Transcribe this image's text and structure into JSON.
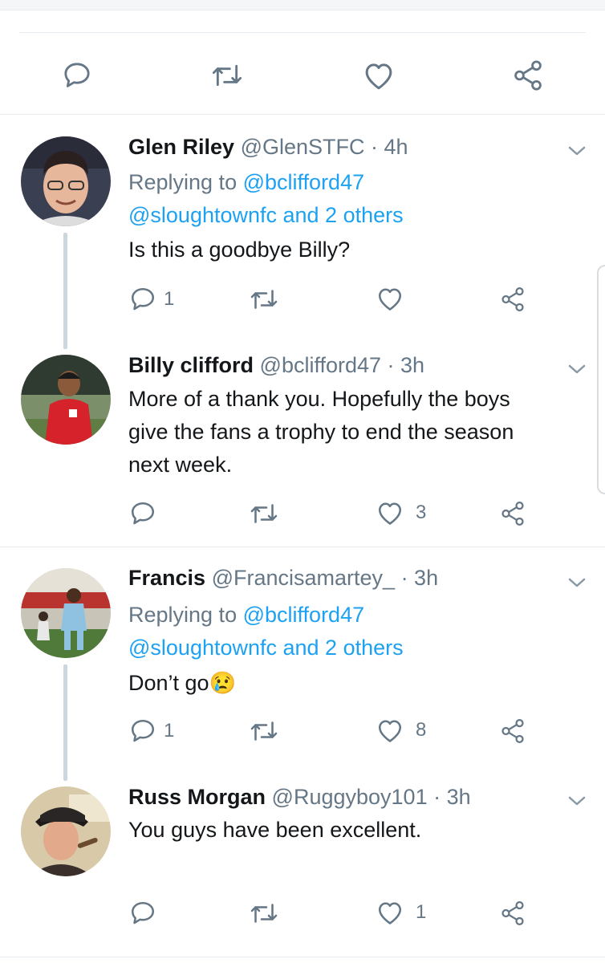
{
  "top_actions": {
    "icons": [
      "reply-icon",
      "retweet-icon",
      "like-icon",
      "share-icon"
    ]
  },
  "replies": [
    {
      "name": "Glen Riley",
      "handle": "@GlenSTFC",
      "time": "· 4h",
      "replying_prefix": "Replying to",
      "replying_to": "@bclifford47",
      "others_line": "@sloughtownfc and 2 others",
      "text": "Is this a goodbye Billy?",
      "reply_count": "1",
      "retweet_count": "",
      "like_count": ""
    },
    {
      "name": "Billy clifford",
      "handle": "@bclifford47",
      "time": "· 3h",
      "text_lines": [
        "More of a thank you. Hopefully the boys",
        "give the fans a trophy to end the season",
        "next week."
      ],
      "reply_count": "",
      "retweet_count": "",
      "like_count": "3"
    },
    {
      "name": "Francis",
      "handle": "@Francisamartey_",
      "time": "· 3h",
      "replying_prefix": "Replying to",
      "replying_to": "@bclifford47",
      "others_line": "@sloughtownfc and 2 others",
      "text": "Don’t go",
      "emoji": "😢",
      "reply_count": "1",
      "retweet_count": "",
      "like_count": "8"
    },
    {
      "name": "Russ Morgan",
      "handle": "@Ruggyboy101",
      "time": "· 3h",
      "text": "You guys have been excellent.",
      "reply_count": "",
      "retweet_count": "",
      "like_count": "1"
    }
  ],
  "colors": {
    "icon": "#657786",
    "link": "#1da1f2",
    "text": "#14171a",
    "divider": "#e6ecf0"
  }
}
